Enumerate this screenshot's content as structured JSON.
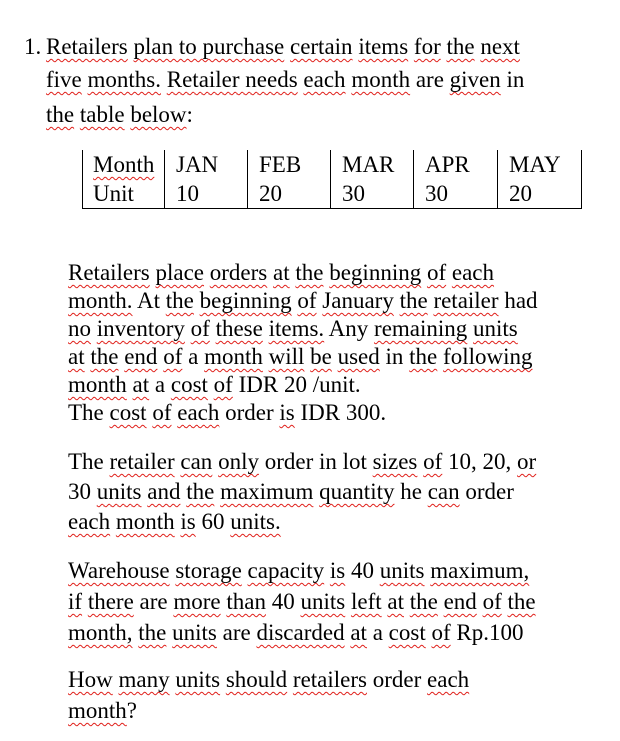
{
  "question": {
    "number": "1.",
    "intro_lines": [
      [
        {
          "t": "Retailers",
          "s": true
        },
        {
          "t": " "
        },
        {
          "t": "plan to purchase",
          "s": true
        },
        {
          "t": " "
        },
        {
          "t": "certain",
          "s": true
        },
        {
          "t": " "
        },
        {
          "t": "items",
          "s": true
        },
        {
          "t": " "
        },
        {
          "t": "for",
          "s": true
        },
        {
          "t": " "
        },
        {
          "t": "the",
          "s": true
        },
        {
          "t": " "
        },
        {
          "t": "next",
          "s": true
        }
      ],
      [
        {
          "t": "five",
          "s": true
        },
        {
          "t": " "
        },
        {
          "t": "months.",
          "s": true
        },
        {
          "t": " "
        },
        {
          "t": "Retailer needs",
          "s": true
        },
        {
          "t": " "
        },
        {
          "t": "each",
          "s": true
        },
        {
          "t": " "
        },
        {
          "t": "month",
          "s": true
        },
        {
          "t": " are "
        },
        {
          "t": "given",
          "s": true
        },
        {
          "t": " in"
        }
      ],
      [
        {
          "t": "the",
          "s": true
        },
        {
          "t": " "
        },
        {
          "t": "table",
          "s": true
        },
        {
          "t": " "
        },
        {
          "t": "below",
          "s": true
        },
        {
          "t": ":"
        }
      ]
    ]
  },
  "table": {
    "header": {
      "label": "Month",
      "months": [
        "JAN",
        "FEB",
        "MAR",
        "APR",
        "MAY"
      ]
    },
    "row": {
      "label": "Unit",
      "values": [
        "10",
        "20",
        "30",
        "30",
        "20"
      ]
    }
  },
  "paragraphs": [
    [
      [
        {
          "t": "Retailers",
          "s": true
        },
        {
          "t": " "
        },
        {
          "t": "place",
          "s": true
        },
        {
          "t": " "
        },
        {
          "t": "orders",
          "s": true
        },
        {
          "t": " "
        },
        {
          "t": "at",
          "s": true
        },
        {
          "t": " "
        },
        {
          "t": "the",
          "s": true
        },
        {
          "t": " "
        },
        {
          "t": "beginning",
          "s": true
        },
        {
          "t": " "
        },
        {
          "t": "of",
          "s": true
        },
        {
          "t": " "
        },
        {
          "t": "each",
          "s": true
        }
      ],
      [
        {
          "t": "month.",
          "s": true
        },
        {
          "t": " At "
        },
        {
          "t": "the",
          "s": true
        },
        {
          "t": " "
        },
        {
          "t": "beginning",
          "s": true
        },
        {
          "t": " "
        },
        {
          "t": "of",
          "s": true
        },
        {
          "t": " "
        },
        {
          "t": "January",
          "s": true
        },
        {
          "t": " "
        },
        {
          "t": "the",
          "s": true
        },
        {
          "t": " "
        },
        {
          "t": "retailer",
          "s": true
        },
        {
          "t": " had"
        }
      ],
      [
        {
          "t": "no",
          "s": true
        },
        {
          "t": " "
        },
        {
          "t": "inventory",
          "s": true
        },
        {
          "t": " "
        },
        {
          "t": "of",
          "s": true
        },
        {
          "t": " "
        },
        {
          "t": "these",
          "s": true
        },
        {
          "t": " "
        },
        {
          "t": "items.",
          "s": true
        },
        {
          "t": " Any "
        },
        {
          "t": "remaining",
          "s": true
        },
        {
          "t": " "
        },
        {
          "t": "units",
          "s": true
        }
      ],
      [
        {
          "t": "at",
          "s": true
        },
        {
          "t": " "
        },
        {
          "t": "the",
          "s": true
        },
        {
          "t": " "
        },
        {
          "t": "end",
          "s": true
        },
        {
          "t": " "
        },
        {
          "t": "of",
          "s": true
        },
        {
          "t": " a "
        },
        {
          "t": "month",
          "s": true
        },
        {
          "t": " "
        },
        {
          "t": "will",
          "s": true
        },
        {
          "t": " "
        },
        {
          "t": "be",
          "s": true
        },
        {
          "t": " "
        },
        {
          "t": "used",
          "s": true
        },
        {
          "t": " in "
        },
        {
          "t": "the",
          "s": true
        },
        {
          "t": " "
        },
        {
          "t": "following",
          "s": true
        }
      ],
      [
        {
          "t": "month",
          "s": true
        },
        {
          "t": " "
        },
        {
          "t": "at",
          "s": true
        },
        {
          "t": " a "
        },
        {
          "t": "cost",
          "s": true
        },
        {
          "t": " "
        },
        {
          "t": "of",
          "s": true
        },
        {
          "t": " IDR 20 /unit."
        }
      ],
      [
        {
          "t": "The "
        },
        {
          "t": "cost",
          "s": true
        },
        {
          "t": " "
        },
        {
          "t": "of",
          "s": true
        },
        {
          "t": " "
        },
        {
          "t": "each",
          "s": true
        },
        {
          "t": " order "
        },
        {
          "t": "is",
          "s": true
        },
        {
          "t": " IDR 300."
        }
      ]
    ],
    [
      [
        {
          "t": "The "
        },
        {
          "t": "retailer",
          "s": true
        },
        {
          "t": " "
        },
        {
          "t": "can",
          "s": true
        },
        {
          "t": " "
        },
        {
          "t": "only",
          "s": true
        },
        {
          "t": " order in lot "
        },
        {
          "t": "sizes",
          "s": true
        },
        {
          "t": " "
        },
        {
          "t": "of",
          "s": true
        },
        {
          "t": " 10, 20, "
        },
        {
          "t": "or",
          "s": true
        }
      ],
      [
        {
          "t": "30 "
        },
        {
          "t": "units",
          "s": true
        },
        {
          "t": " "
        },
        {
          "t": "and",
          "s": true
        },
        {
          "t": " "
        },
        {
          "t": "the",
          "s": true
        },
        {
          "t": " "
        },
        {
          "t": "maximum",
          "s": true
        },
        {
          "t": " "
        },
        {
          "t": "quantity",
          "s": true
        },
        {
          "t": " he "
        },
        {
          "t": "can",
          "s": true
        },
        {
          "t": " order"
        }
      ],
      [
        {
          "t": "each",
          "s": true
        },
        {
          "t": " "
        },
        {
          "t": "month",
          "s": true
        },
        {
          "t": " "
        },
        {
          "t": "is",
          "s": true
        },
        {
          "t": " 60 "
        },
        {
          "t": "units.",
          "s": true
        }
      ]
    ],
    [
      [
        {
          "t": "Warehouse",
          "s": true
        },
        {
          "t": " "
        },
        {
          "t": "storage",
          "s": true
        },
        {
          "t": " "
        },
        {
          "t": "capacity",
          "s": true
        },
        {
          "t": " "
        },
        {
          "t": "is",
          "s": true
        },
        {
          "t": " 40 "
        },
        {
          "t": "units",
          "s": true
        },
        {
          "t": " "
        },
        {
          "t": "maximum,",
          "s": true
        }
      ],
      [
        {
          "t": "if",
          "s": true
        },
        {
          "t": " "
        },
        {
          "t": "there",
          "s": true
        },
        {
          "t": " are "
        },
        {
          "t": "more",
          "s": true
        },
        {
          "t": " "
        },
        {
          "t": "than",
          "s": true
        },
        {
          "t": " 40 "
        },
        {
          "t": "units",
          "s": true
        },
        {
          "t": " "
        },
        {
          "t": "left",
          "s": true
        },
        {
          "t": " "
        },
        {
          "t": "at",
          "s": true
        },
        {
          "t": " "
        },
        {
          "t": "the",
          "s": true
        },
        {
          "t": " "
        },
        {
          "t": "end",
          "s": true
        },
        {
          "t": " "
        },
        {
          "t": "of",
          "s": true
        },
        {
          "t": " "
        },
        {
          "t": "the",
          "s": true
        }
      ],
      [
        {
          "t": "month,",
          "s": true
        },
        {
          "t": " "
        },
        {
          "t": "the",
          "s": true
        },
        {
          "t": " "
        },
        {
          "t": "units",
          "s": true
        },
        {
          "t": " are "
        },
        {
          "t": "discarded",
          "s": true
        },
        {
          "t": " "
        },
        {
          "t": "at",
          "s": true
        },
        {
          "t": " a "
        },
        {
          "t": "cost",
          "s": true
        },
        {
          "t": " "
        },
        {
          "t": "of",
          "s": true
        },
        {
          "t": " Rp.100"
        }
      ]
    ],
    [
      [
        {
          "t": "How",
          "s": true
        },
        {
          "t": " "
        },
        {
          "t": "many",
          "s": true
        },
        {
          "t": " "
        },
        {
          "t": "units",
          "s": true
        },
        {
          "t": " "
        },
        {
          "t": "should",
          "s": true
        },
        {
          "t": " "
        },
        {
          "t": "retailers",
          "s": true
        },
        {
          "t": " order "
        },
        {
          "t": "each",
          "s": true
        }
      ],
      [
        {
          "t": "month",
          "s": true
        },
        {
          "t": "?"
        }
      ]
    ]
  ]
}
